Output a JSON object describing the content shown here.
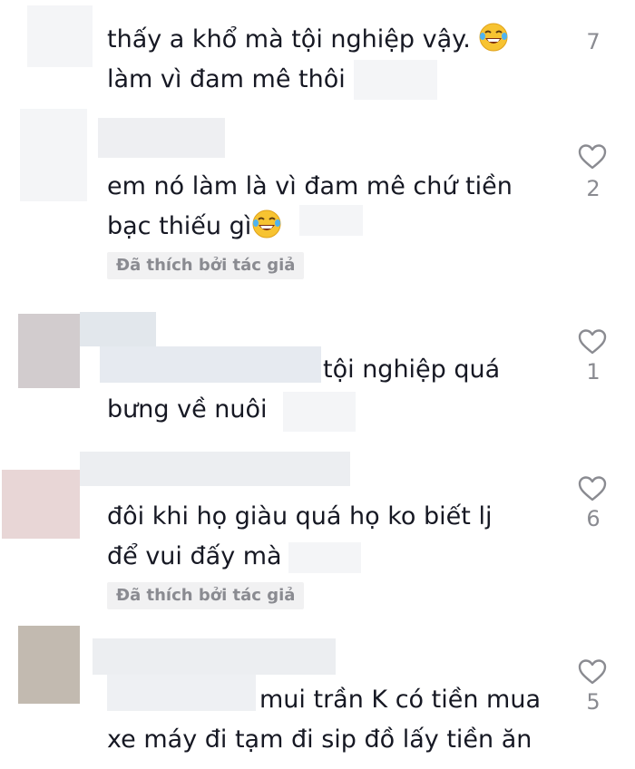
{
  "comments": [
    {
      "lines": [
        "thấy a khổ mà tội nghiệp vậy.",
        "làm vì đam mê thôi"
      ],
      "like_count": "7"
    },
    {
      "lines": [
        "em nó làm là vì đam mê chứ tiền",
        "bạc thiếu gì"
      ],
      "badge": "Đã thích bởi tác giả",
      "like_count": "2"
    },
    {
      "lines": [
        "tội nghiệp quá",
        "bưng về nuôi"
      ],
      "like_count": "1"
    },
    {
      "lines": [
        "đôi khi họ giàu quá họ ko biết lj",
        "để vui đấy mà"
      ],
      "badge": "Đã thích bởi tác giả",
      "like_count": "6"
    },
    {
      "lines": [
        "mui trần K có tiền mua",
        "xe máy đi tạm đi sip đồ lấy tiền ăn"
      ],
      "like_count": "5"
    }
  ],
  "icons": {
    "like": "heart-outline-icon",
    "emoji": "laughing-tears-emoji-icon"
  },
  "colors": {
    "text": "#161823",
    "muted": "#8a8b91",
    "badge_bg": "#f1f1f2"
  }
}
